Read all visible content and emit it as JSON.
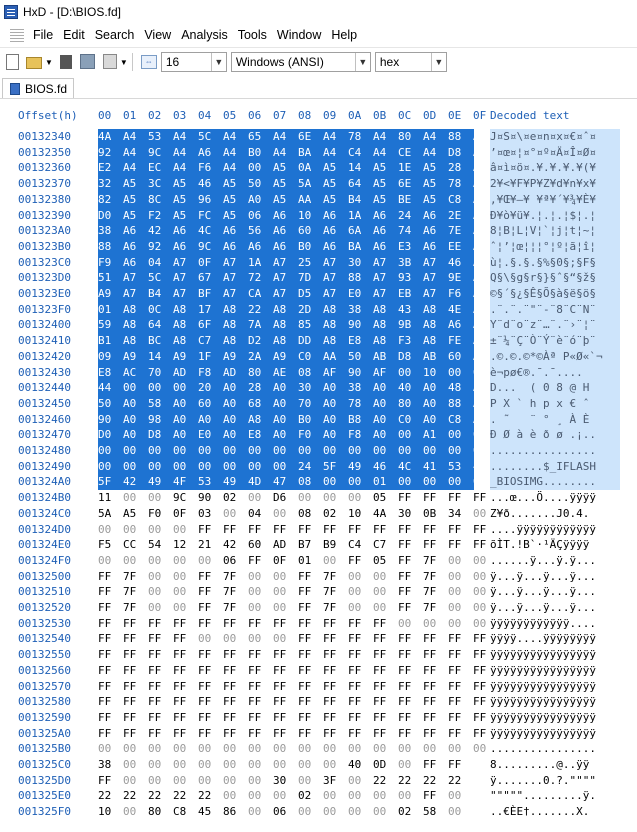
{
  "window": {
    "title": "HxD - [D:\\BIOS.fd]"
  },
  "menu": {
    "items": [
      "File",
      "Edit",
      "Search",
      "View",
      "Analysis",
      "Tools",
      "Window",
      "Help"
    ]
  },
  "toolbar": {
    "bytes_per_row": "16",
    "charset": "Windows (ANSI)",
    "mode": "hex"
  },
  "tab": {
    "label": "BIOS.fd"
  },
  "hex": {
    "offset_header": "Offset(h)",
    "columns": [
      "00",
      "01",
      "02",
      "03",
      "04",
      "05",
      "06",
      "07",
      "08",
      "09",
      "0A",
      "0B",
      "0C",
      "0D",
      "0E",
      "0F"
    ],
    "decoded_header": "Decoded text",
    "rows": [
      {
        "offset": "00132340",
        "bytes": "4A A4 53 A4 5C A4 65 A4 6E A4 78 A4 80 A4 88 A4",
        "text": "J¤S¤\\¤e¤n¤x¤€¤ˆ¤",
        "sel": true
      },
      {
        "offset": "00132350",
        "bytes": "92 A4 9C A4 A6 A4 B0 A4 BA A4 C4 A4 CE A4 D8 A4",
        "text": "’¤œ¤¦¤°¤º¤Ä¤Î¤Ø¤",
        "sel": true
      },
      {
        "offset": "00132360",
        "bytes": "E2 A4 EC A4 F6 A4 00 A5 0A A5 14 A5 1E A5 28 A5",
        "text": "â¤ì¤ö¤.¥.¥.¥.¥(¥",
        "sel": true
      },
      {
        "offset": "00132370",
        "bytes": "32 A5 3C A5 46 A5 50 A5 5A A5 64 A5 6E A5 78 A5",
        "text": "2¥<¥F¥P¥Z¥d¥n¥x¥",
        "sel": true
      },
      {
        "offset": "00132380",
        "bytes": "82 A5 8C A5 96 A5 A0 A5 AA A5 B4 A5 BE A5 C8 A5",
        "text": "‚¥Œ¥–¥ ¥ª¥´¥¾¥È¥",
        "sel": true
      },
      {
        "offset": "00132390",
        "bytes": "D0 A5 F2 A5 FC A5 06 A6 10 A6 1A A6 24 A6 2E A6",
        "text": "Ð¥ò¥ü¥.¦.¦.¦$¦.¦",
        "sel": true
      },
      {
        "offset": "001323A0",
        "bytes": "38 A6 42 A6 4C A6 56 A6 60 A6 6A A6 74 A6 7E A6",
        "text": "8¦B¦L¦V¦`¦j¦t¦~¦",
        "sel": true
      },
      {
        "offset": "001323B0",
        "bytes": "88 A6 92 A6 9C A6 A6 A6 B0 A6 BA A6 E3 A6 EE A6",
        "text": "ˆ¦’¦œ¦¦¦°¦º¦ã¦î¦",
        "sel": true
      },
      {
        "offset": "001323C0",
        "bytes": "F9 A6 04 A7 0F A7 1A A7 25 A7 30 A7 3B A7 46 A7",
        "text": "ù¦.§.§.§%§0§;§F§",
        "sel": true
      },
      {
        "offset": "001323D0",
        "bytes": "51 A7 5C A7 67 A7 72 A7 7D A7 88 A7 93 A7 9E A7",
        "text": "Q§\\§g§r§}§ˆ§“§ž§",
        "sel": true
      },
      {
        "offset": "001323E0",
        "bytes": "A9 A7 B4 A7 BF A7 CA A7 D5 A7 E0 A7 EB A7 F6 A7",
        "text": "©§´§¿§Ê§Õ§à§ë§ö§",
        "sel": true
      },
      {
        "offset": "001323F0",
        "bytes": "01 A8 0C A8 17 A8 22 A8 2D A8 38 A8 43 A8 4E A8",
        "text": ".¨.¨.¨\"¨-¨8¨C¨N¨",
        "sel": true
      },
      {
        "offset": "00132400",
        "bytes": "59 A8 64 A8 6F A8 7A A8 85 A8 90 A8 9B A8 A6 A8",
        "text": "Y¨d¨o¨z¨…¨.¨›¨¦¨",
        "sel": true
      },
      {
        "offset": "00132410",
        "bytes": "B1 A8 BC A8 C7 A8 D2 A8 DD A8 E8 A8 F3 A8 FE A8",
        "text": "±¨¼¨Ç¨Ò¨Ý¨è¨ó¨þ¨",
        "sel": true
      },
      {
        "offset": "00132420",
        "bytes": "09 A9 14 A9 1F A9 2A A9 C0 AA 50 AB D8 AB 60 AC",
        "text": ".©.©.©*©Àª P«Ø«`¬",
        "sel": true
      },
      {
        "offset": "00132430",
        "bytes": "E8 AC 70 AD F8 AD 80 AE 08 AF 90 AF 00 10 00 00",
        "text": "è¬p­ø­€®.¯.¯....",
        "sel": true
      },
      {
        "offset": "00132440",
        "bytes": "44 00 00 00 20 A0 28 A0 30 A0 38 A0 40 A0 48 A0",
        "text": "D...  ( 0 8 @ H ",
        "sel": true
      },
      {
        "offset": "00132450",
        "bytes": "50 A0 58 A0 60 A0 68 A0 70 A0 78 A0 80 A0 88 A0",
        "text": "P X ` h p x € ˆ ",
        "sel": true
      },
      {
        "offset": "00132460",
        "bytes": "90 A0 98 A0 A0 A0 A8 A0 B0 A0 B8 A0 C0 A0 C8 A0",
        "text": ". ˜   ¨ ° ¸ À È ",
        "sel": true
      },
      {
        "offset": "00132470",
        "bytes": "D0 A0 D8 A0 E0 A0 E8 A0 F0 A0 F8 A0 00 A1 00 00",
        "text": "Ð Ø à è ð ø .¡..",
        "sel": true
      },
      {
        "offset": "00132480",
        "bytes": "00 00 00 00 00 00 00 00 00 00 00 00 00 00 00 00",
        "text": "................",
        "sel": true
      },
      {
        "offset": "00132490",
        "bytes": "00 00 00 00 00 00 00 00 24 5F 49 46 4C 41 53 48",
        "text": "........$_IFLASH",
        "sel": true
      },
      {
        "offset": "001324A0",
        "bytes": "5F 42 49 4F 53 49 4D 47 08 00 00 01 00 00 00 01",
        "text": "_BIOSIMG........",
        "sel": true
      },
      {
        "offset": "001324B0",
        "bytes": "11 00 00 9C 90 02 00 D6 00 00 00 05 FF FF FF FF",
        "text": "...œ...Ö....ÿÿÿÿ",
        "sel": false
      },
      {
        "offset": "001324C0",
        "bytes": "5A A5 F0 0F 03 00 04 00 08 02 10 4A 30 0B 34 00",
        "text": "Z¥ð.......J0.4.",
        "sel": false
      },
      {
        "offset": "001324D0",
        "bytes": "00 00 00 00 FF FF FF FF FF FF FF FF FF FF FF FF",
        "text": "....ÿÿÿÿÿÿÿÿÿÿÿÿ",
        "sel": false
      },
      {
        "offset": "001324E0",
        "bytes": "F5 CC 54 12 21 42 60 AD B7 B9 C4 C7 FF FF FF FF",
        "text": "õÌT.!B`­·¹ÄÇÿÿÿÿ",
        "sel": false
      },
      {
        "offset": "001324F0",
        "bytes": "00 00 00 00 00 06 FF 0F 01 00 FF 05 FF 7F 00 00",
        "text": "......ÿ...ÿ.ÿ...",
        "sel": false
      },
      {
        "offset": "00132500",
        "bytes": "FF 7F 00 00 FF 7F 00 00 FF 7F 00 00 FF 7F 00 00",
        "text": "ÿ...ÿ...ÿ...ÿ...",
        "sel": false
      },
      {
        "offset": "00132510",
        "bytes": "FF 7F 00 00 FF 7F 00 00 FF 7F 00 00 FF 7F 00 00",
        "text": "ÿ...ÿ...ÿ...ÿ...",
        "sel": false
      },
      {
        "offset": "00132520",
        "bytes": "FF 7F 00 00 FF 7F 00 00 FF 7F 00 00 FF 7F 00 00",
        "text": "ÿ...ÿ...ÿ...ÿ...",
        "sel": false
      },
      {
        "offset": "00132530",
        "bytes": "FF FF FF FF FF FF FF FF FF FF FF FF 00 00 00 00",
        "text": "ÿÿÿÿÿÿÿÿÿÿÿÿ....",
        "sel": false
      },
      {
        "offset": "00132540",
        "bytes": "FF FF FF FF 00 00 00 00 FF FF FF FF FF FF FF FF",
        "text": "ÿÿÿÿ....ÿÿÿÿÿÿÿÿ",
        "sel": false
      },
      {
        "offset": "00132550",
        "bytes": "FF FF FF FF FF FF FF FF FF FF FF FF FF FF FF FF",
        "text": "ÿÿÿÿÿÿÿÿÿÿÿÿÿÿÿÿ",
        "sel": false
      },
      {
        "offset": "00132560",
        "bytes": "FF FF FF FF FF FF FF FF FF FF FF FF FF FF FF FF",
        "text": "ÿÿÿÿÿÿÿÿÿÿÿÿÿÿÿÿ",
        "sel": false
      },
      {
        "offset": "00132570",
        "bytes": "FF FF FF FF FF FF FF FF FF FF FF FF FF FF FF FF",
        "text": "ÿÿÿÿÿÿÿÿÿÿÿÿÿÿÿÿ",
        "sel": false
      },
      {
        "offset": "00132580",
        "bytes": "FF FF FF FF FF FF FF FF FF FF FF FF FF FF FF FF",
        "text": "ÿÿÿÿÿÿÿÿÿÿÿÿÿÿÿÿ",
        "sel": false
      },
      {
        "offset": "00132590",
        "bytes": "FF FF FF FF FF FF FF FF FF FF FF FF FF FF FF FF",
        "text": "ÿÿÿÿÿÿÿÿÿÿÿÿÿÿÿÿ",
        "sel": false
      },
      {
        "offset": "001325A0",
        "bytes": "FF FF FF FF FF FF FF FF FF FF FF FF FF FF FF FF",
        "text": "ÿÿÿÿÿÿÿÿÿÿÿÿÿÿÿÿ",
        "sel": false
      },
      {
        "offset": "001325B0",
        "bytes": "00 00 00 00 00 00 00 00 00 00 00 00 00 00 00 00",
        "text": "................",
        "sel": false
      },
      {
        "offset": "001325C0",
        "bytes": "38 00 00 00 00 00 00 00 00 00 40 0D 00 FF FF",
        "text": "8.........@..ÿÿ",
        "sel": false
      },
      {
        "offset": "001325D0",
        "bytes": "FF 00 00 00 00 00 00 30 00 3F 00 22 22 22 22",
        "text": "ÿ.......0.?.\"\"\"\"",
        "sel": false
      },
      {
        "offset": "001325E0",
        "bytes": "22 22 22 22 22 00 00 00 02 00 00 00 00 FF 00",
        "text": "\"\"\"\"\".........ÿ.",
        "sel": false
      },
      {
        "offset": "001325F0",
        "bytes": "10 00 80 C8 45 86 00 06 00 00 00 00 02 58 00",
        "text": "..€ÈE†.......X.",
        "sel": false
      }
    ]
  }
}
